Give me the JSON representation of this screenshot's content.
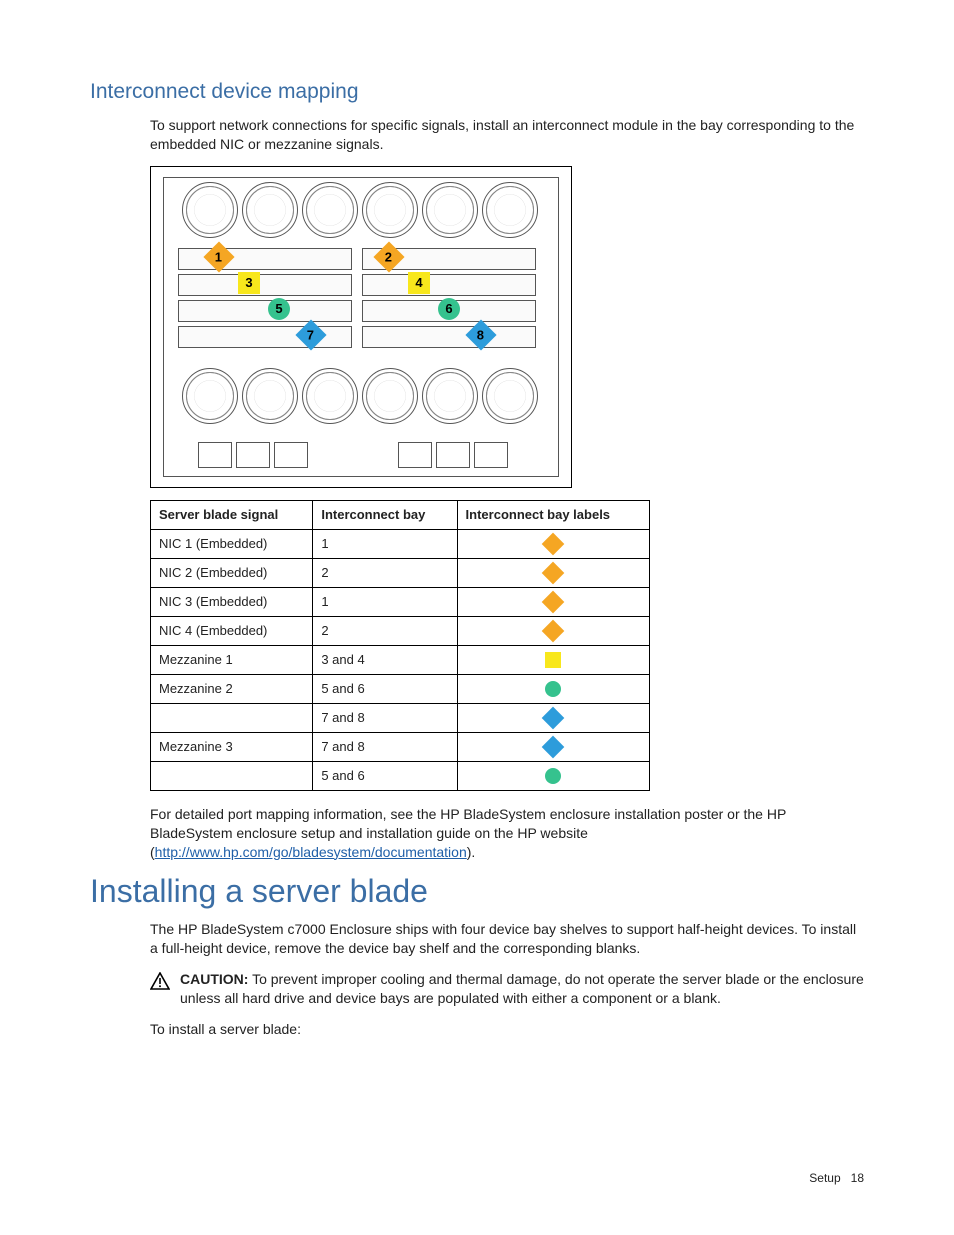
{
  "section1": {
    "heading": "Interconnect device mapping",
    "intro": "To support network connections for specific signals, install an interconnect module in the bay corresponding to the embedded NIC or mezzanine signals.",
    "diagram_callouts": [
      "1",
      "2",
      "3",
      "4",
      "5",
      "6",
      "7",
      "8"
    ],
    "table": {
      "headers": [
        "Server blade signal",
        "Interconnect bay",
        "Interconnect bay labels"
      ],
      "rows": [
        {
          "signal": "NIC 1 (Embedded)",
          "bay": "1",
          "shape": "orange"
        },
        {
          "signal": "NIC 2 (Embedded)",
          "bay": "2",
          "shape": "orange"
        },
        {
          "signal": "NIC 3 (Embedded)",
          "bay": "1",
          "shape": "orange"
        },
        {
          "signal": "NIC 4 (Embedded)",
          "bay": "2",
          "shape": "orange"
        },
        {
          "signal": "Mezzanine 1",
          "bay": "3 and 4",
          "shape": "yellow"
        },
        {
          "signal": "Mezzanine 2",
          "bay": "5 and 6",
          "shape": "green"
        },
        {
          "signal": "",
          "bay": "7 and 8",
          "shape": "blue"
        },
        {
          "signal": "Mezzanine 3",
          "bay": "7 and 8",
          "shape": "blue"
        },
        {
          "signal": "",
          "bay": "5 and 6",
          "shape": "green"
        }
      ]
    },
    "footnote_pre": "For detailed port mapping information, see the HP BladeSystem enclosure installation poster or the HP BladeSystem enclosure setup and installation guide on the HP website (",
    "footnote_link": "http://www.hp.com/go/bladesystem/documentation",
    "footnote_post": ")."
  },
  "section2": {
    "heading": "Installing a server blade",
    "p1": "The HP BladeSystem c7000 Enclosure ships with four device bay shelves to support half-height devices. To install a full-height device, remove the device bay shelf and the corresponding blanks.",
    "caution_label": "CAUTION:",
    "caution_text": "To prevent improper cooling and thermal damage, do not operate the server blade or the enclosure unless all hard drive and device bays are populated with either a component or a blank.",
    "p2": "To install a server blade:"
  },
  "footer": {
    "section": "Setup",
    "page": "18"
  }
}
